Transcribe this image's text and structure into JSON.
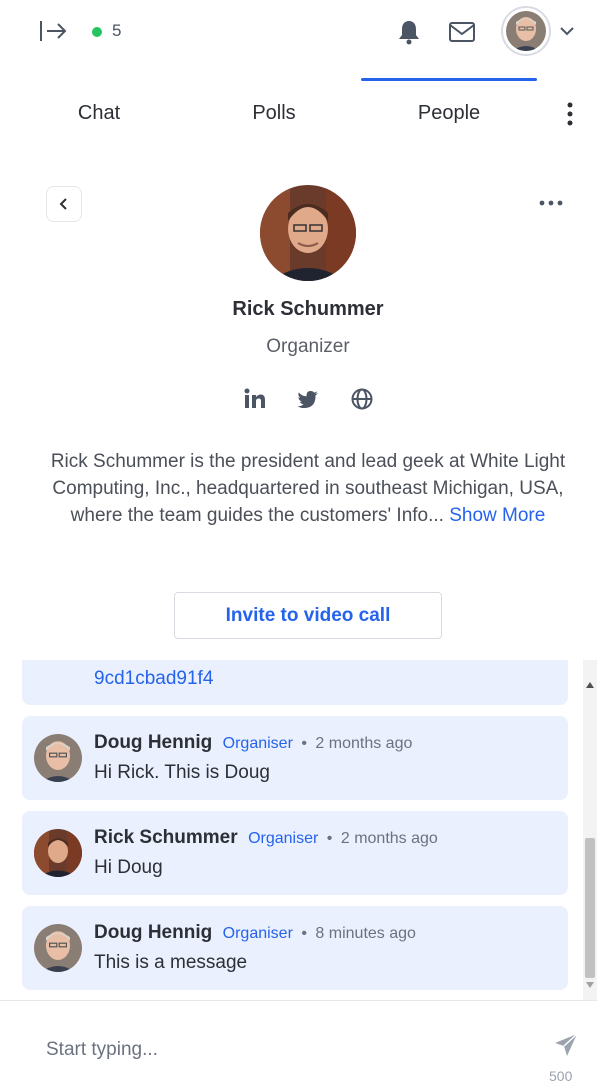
{
  "topbar": {
    "online_count": "5",
    "online_color": "#22c55e"
  },
  "tabs": [
    {
      "label": "Chat"
    },
    {
      "label": "Polls"
    },
    {
      "label": "People",
      "active": true
    }
  ],
  "profile": {
    "name": "Rick Schummer",
    "role": "Organizer",
    "bio": "Rick Schummer is the president and lead geek at White Light Computing, Inc., headquartered in southeast Michigan, USA, where the team guides the customers' Info...",
    "show_more": "Show More",
    "invite_label": "Invite to video call",
    "social": [
      "linkedin-icon",
      "twitter-icon",
      "globe-icon"
    ]
  },
  "chat": {
    "partial_text": "9cd1cbad91f4",
    "messages": [
      {
        "author": "Doug Hennig",
        "role": "Organiser",
        "time": "2 months ago",
        "text": "Hi Rick. This is Doug"
      },
      {
        "author": "Rick Schummer",
        "role": "Organiser",
        "time": "2 months ago",
        "text": "Hi Doug"
      },
      {
        "author": "Doug Hennig",
        "role": "Organiser",
        "time": "8 minutes ago",
        "text": "This is a message"
      }
    ]
  },
  "composer": {
    "placeholder": "Start typing...",
    "char_limit": "500"
  },
  "colors": {
    "accent": "#2563eb",
    "message_bg": "#eaf0fd"
  }
}
